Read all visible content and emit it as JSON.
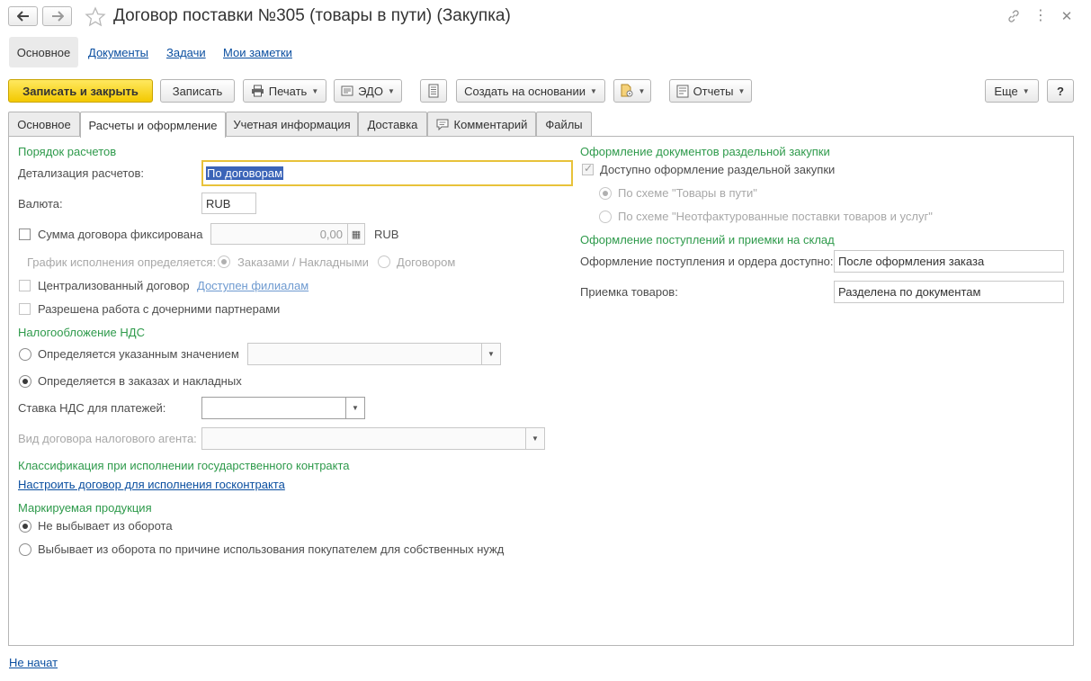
{
  "header": {
    "title": "Договор поставки №305 (товары в пути) (Закупка)"
  },
  "nav": {
    "main": "Основное",
    "documents": "Документы",
    "tasks": "Задачи",
    "notes": "Мои заметки"
  },
  "toolbar": {
    "save_close": "Записать и закрыть",
    "save": "Записать",
    "print": "Печать",
    "edo": "ЭДО",
    "create_based": "Создать на основании",
    "reports": "Отчеты",
    "more": "Еще",
    "help": "?"
  },
  "tabs": [
    "Основное",
    "Расчеты и оформление",
    "Учетная информация",
    "Доставка",
    "Комментарий",
    "Файлы"
  ],
  "form": {
    "settlement_section": "Порядок расчетов",
    "detail_label": "Детализация расчетов:",
    "detail_value": "По договорам",
    "currency_label": "Валюта:",
    "currency_value": "RUB",
    "fixed_sum_label": "Сумма договора фиксирована",
    "fixed_sum_value": "0,00",
    "fixed_sum_currency": "RUB",
    "schedule_label": "График исполнения определяется:",
    "schedule_opt1": "Заказами / Накладными",
    "schedule_opt2": "Договором",
    "centralized_label": "Централизованный договор",
    "centralized_link": "Доступен филиалам",
    "subsidiary_label": "Разрешена работа с дочерними партнерами",
    "vat_section": "Налогообложение НДС",
    "vat_opt1": "Определяется указанным значением",
    "vat_opt2": "Определяется в заказах и накладных",
    "vat_rate_label": "Ставка НДС для платежей:",
    "tax_agent_label": "Вид договора налогового агента:",
    "gov_section": "Классификация при исполнении государственного контракта",
    "gov_link": "Настроить договор для исполнения госконтракта",
    "marking_section": "Маркируемая продукция",
    "marking_opt1": "Не выбывает из оборота",
    "marking_opt2": "Выбывает из оборота по причине использования покупателем для собственных нужд",
    "separate_section": "Оформление документов раздельной закупки",
    "separate_check": "Доступно оформление раздельной закупки",
    "separate_opt1": "По схеме \"Товары в пути\"",
    "separate_opt2": "По схеме \"Неотфактурованные поставки товаров и услуг\"",
    "receipt_section": "Оформление поступлений и приемки на склад",
    "receipt_label": "Оформление поступления и ордера доступно:",
    "receipt_value": "После оформления заказа",
    "acceptance_label": "Приемка товаров:",
    "acceptance_value": "Разделена по документам"
  },
  "footer": {
    "status_link": "Не начат"
  },
  "colors": {
    "section": "#2e9a4b",
    "link": "#0b4fa0",
    "primary": "#f3c900",
    "focus": "#e8c23a",
    "selection": "#3b64b8"
  }
}
